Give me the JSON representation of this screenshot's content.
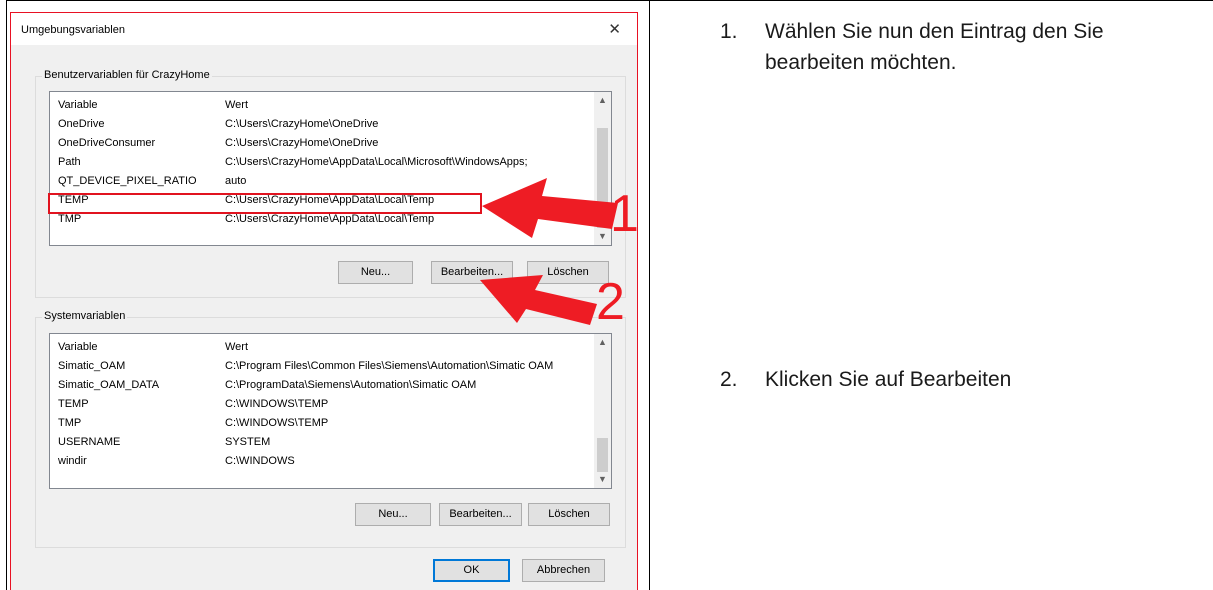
{
  "dialog": {
    "title": "Umgebungsvariablen",
    "close_icon": "close-icon",
    "user_group_label": "Benutzervariablen für CrazyHome",
    "system_group_label": "Systemvariablen",
    "columns": [
      "Variable",
      "Wert"
    ],
    "user_vars": [
      {
        "name": "OneDrive",
        "value": "C:\\Users\\CrazyHome\\OneDrive"
      },
      {
        "name": "OneDriveConsumer",
        "value": "C:\\Users\\CrazyHome\\OneDrive"
      },
      {
        "name": "Path",
        "value": "C:\\Users\\CrazyHome\\AppData\\Local\\Microsoft\\WindowsApps;"
      },
      {
        "name": "QT_DEVICE_PIXEL_RATIO",
        "value": "auto"
      },
      {
        "name": "TEMP",
        "value": "C:\\Users\\CrazyHome\\AppData\\Local\\Temp"
      },
      {
        "name": "TMP",
        "value": "C:\\Users\\CrazyHome\\AppData\\Local\\Temp"
      }
    ],
    "system_vars": [
      {
        "name": "Simatic_OAM",
        "value": "C:\\Program Files\\Common Files\\Siemens\\Automation\\Simatic OAM"
      },
      {
        "name": "Simatic_OAM_DATA",
        "value": "C:\\ProgramData\\Siemens\\Automation\\Simatic OAM"
      },
      {
        "name": "TEMP",
        "value": "C:\\WINDOWS\\TEMP"
      },
      {
        "name": "TMP",
        "value": "C:\\WINDOWS\\TEMP"
      },
      {
        "name": "USERNAME",
        "value": "SYSTEM"
      },
      {
        "name": "windir",
        "value": "C:\\WINDOWS"
      }
    ],
    "buttons": {
      "new": "Neu...",
      "edit": "Bearbeiten...",
      "delete": "Löschen",
      "ok": "OK",
      "cancel": "Abbrechen"
    }
  },
  "annotations": {
    "marker_1": "1",
    "marker_2": "2",
    "arrow_color": "#ee1c24"
  },
  "instructions": [
    {
      "number": "1.",
      "text": "Wählen Sie nun den Eintrag den Sie bearbeiten möchten."
    },
    {
      "number": "2.",
      "text": "Klicken Sie auf Bearbeiten"
    }
  ]
}
